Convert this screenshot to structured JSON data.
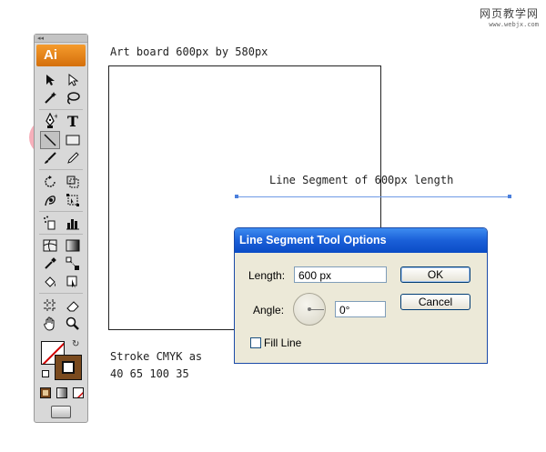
{
  "watermark": {
    "site_cn": "网页教学网",
    "site_url": "www.webjx.com"
  },
  "toolbox": {
    "logo": "Ai",
    "grip": "◂◂"
  },
  "artboard_label": "Art board 600px by 580px",
  "line_label": "Line Segment of 600px length",
  "stroke_note": {
    "line1": "Stroke CMYK as",
    "line2": "40 65 100 35"
  },
  "stroke_color": "#7a4a1e",
  "dialog": {
    "title": "Line Segment Tool Options",
    "length_label": "Length:",
    "length_value": "600 px",
    "angle_label": "Angle:",
    "angle_value": "0°",
    "fill_line_label": "Fill Line",
    "fill_line_checked": false,
    "ok_label": "OK",
    "cancel_label": "Cancel"
  },
  "colors": {
    "accent": "#f59b2c",
    "title_bar": "#1a5fd8",
    "highlight": "#ee6e82",
    "guide_line": "#6e9ae6"
  }
}
